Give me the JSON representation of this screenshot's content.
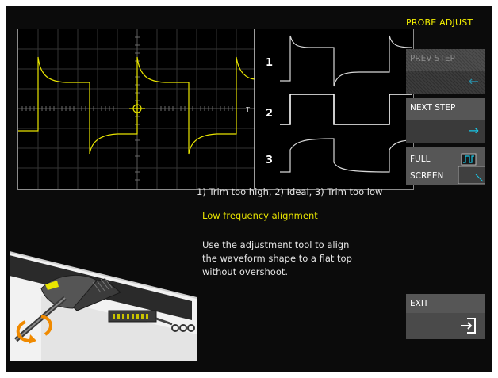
{
  "panel": {
    "title": "PROBE ADJUST"
  },
  "buttons": {
    "prev": {
      "label": "PREV STEP",
      "enabled": false,
      "icon": "arrow-left-icon"
    },
    "next": {
      "label": "NEXT STEP",
      "enabled": true,
      "icon": "arrow-right-icon"
    },
    "full": {
      "line1": "FULL",
      "line2": "SCREEN",
      "icon": "fullscreen-waveform-icon"
    },
    "exit": {
      "label": "EXIT",
      "icon": "exit-icon"
    }
  },
  "scope": {
    "trace_labels": [
      "1",
      "2",
      "3"
    ],
    "trigger_marker": "T"
  },
  "caption": "1) Trim too high, 2) Ideal, 3) Trim too low",
  "step_title": "Low frequency alignment",
  "instructions": [
    "Use the adjustment tool to align",
    "the waveform shape to a flat top",
    "without overshoot."
  ],
  "colors": {
    "accent": "#e8e400",
    "arrow": "#19c6e6",
    "background": "#0b0b0b"
  }
}
